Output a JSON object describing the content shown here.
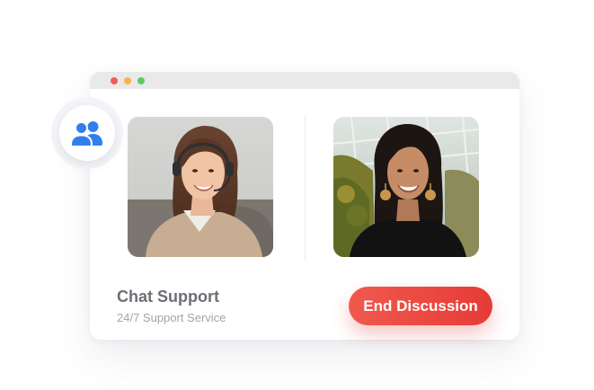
{
  "window": {
    "controls": [
      "close",
      "minimize",
      "maximize"
    ],
    "control_colors": {
      "close": "#ee5d5c",
      "minimize": "#f5b544",
      "maximize": "#5dcb5f"
    }
  },
  "badge": {
    "icon": "users-icon",
    "icon_color": "#2f80ed"
  },
  "participants": [
    {
      "role": "agent",
      "image": "agent-photo"
    },
    {
      "role": "customer",
      "image": "customer-photo"
    }
  ],
  "support": {
    "title": "Chat Support",
    "subtitle": "24/7 Support Service"
  },
  "actions": {
    "end_label": "End Discussion",
    "end_color_start": "#f0594f",
    "end_color_end": "#e63b36"
  }
}
